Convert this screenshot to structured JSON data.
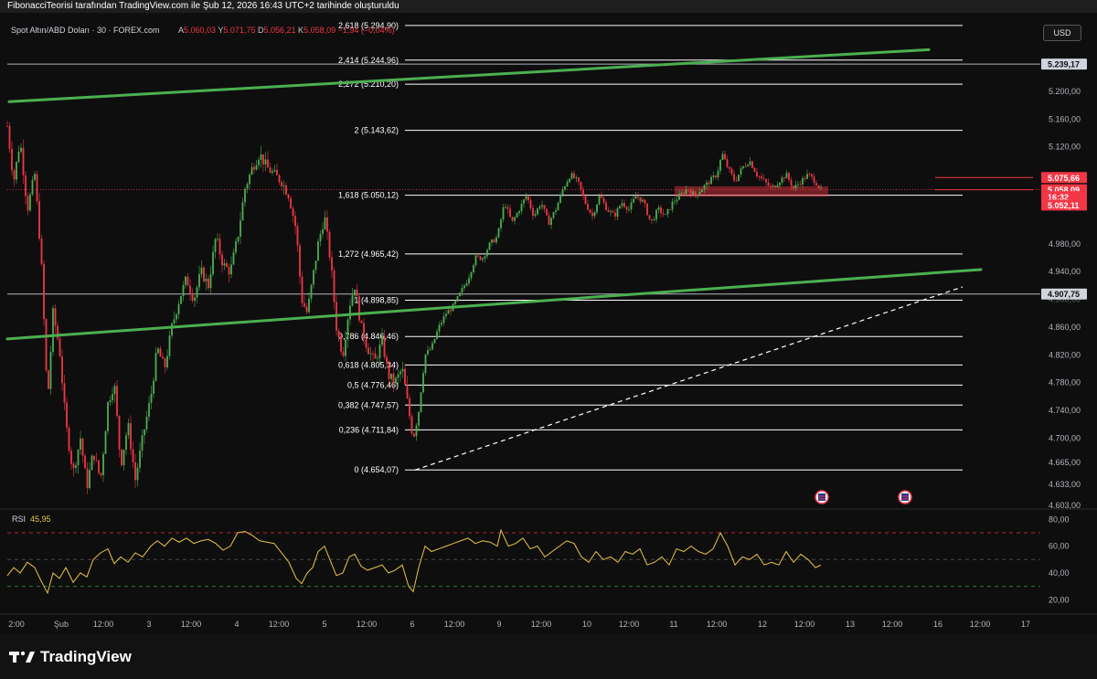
{
  "header": {
    "title": "FibonacciTeorisi tarafından TradingView.com ile Şub 12, 2026 16:43 UTC+2 tarihinde oluşturuldu"
  },
  "symbol": {
    "name": "Spot Altın/ABD Doları · 30 · FOREX.com",
    "open_label": "A",
    "open": "5.060,03",
    "high_label": "Y",
    "high": "5.071,75",
    "low_label": "D",
    "low": "5.056,21",
    "close_label": "K",
    "close": "5.058,09",
    "change": "−1,94 (−0,04%)"
  },
  "currency_button": "USD",
  "footer": {
    "logo_text": "TradingView"
  },
  "colors": {
    "up": "#26a69a",
    "up_candle": "#4caf50",
    "down": "#f23645",
    "trendline": "#4caf50",
    "rsi": "#e8c547",
    "background": "#0e0e0e"
  },
  "chart_data": {
    "type": "candlestick",
    "price_axis": {
      "ylim": [
        4603,
        5300
      ],
      "ticks": [
        "5.200,00",
        "5.160,00",
        "5.120,00",
        "4.980,00",
        "4.940,00",
        "4.860,00",
        "4.820,00",
        "4.780,00",
        "4.740,00",
        "4.700,00",
        "4.665,00",
        "4.633,00",
        "4.603,00"
      ],
      "tick_values": [
        5200,
        5160,
        5120,
        4980,
        4940,
        4860,
        4820,
        4780,
        4740,
        4700,
        4665,
        4633,
        4603
      ],
      "labels": [
        {
          "text": "5.239,17",
          "value": 5239.17,
          "style": "line"
        },
        {
          "text": "5.075,66",
          "value": 5075.66,
          "style": "red"
        },
        {
          "text": "5.058,09",
          "value": 5058.09,
          "style": "red"
        },
        {
          "text": "16:32",
          "value": 5048,
          "style": "red"
        },
        {
          "text": "5.052,11",
          "value": 5036,
          "style": "red"
        },
        {
          "text": "4.907,75",
          "value": 4907.75,
          "style": "line"
        }
      ],
      "partial_tick": "4.900,00"
    },
    "time_axis": {
      "ticks": [
        "2:00",
        "Şub",
        "12:00",
        "3",
        "12:00",
        "4",
        "12:00",
        "5",
        "12:00",
        "6",
        "12:00",
        "9",
        "12:00",
        "10",
        "12:00",
        "11",
        "12:00",
        "12",
        "12:00",
        "13",
        "12:00",
        "16",
        "12:00",
        "17"
      ],
      "tick_x": [
        18,
        67,
        113,
        163,
        209,
        259,
        305,
        355,
        401,
        451,
        497,
        546,
        592,
        642,
        688,
        737,
        784,
        834,
        880,
        930,
        976,
        1026,
        1072,
        1122
      ]
    },
    "fibonacci_levels": [
      {
        "ratio": "2,618",
        "price": "5.294,90",
        "value": 5294.9
      },
      {
        "ratio": "2,414",
        "price": "5.244,96",
        "value": 5244.96
      },
      {
        "ratio": "2,272",
        "price": "5.210,20",
        "value": 5210.2
      },
      {
        "ratio": "2",
        "price": "5.143,62",
        "value": 5143.62
      },
      {
        "ratio": "1,618",
        "price": "5.050,12",
        "value": 5050.12
      },
      {
        "ratio": "1,272",
        "price": "4.965,42",
        "value": 4965.42
      },
      {
        "ratio": "1",
        "price": "4.898,85",
        "value": 4898.85
      },
      {
        "ratio": "0,786",
        "price": "4.846,46",
        "value": 4846.46
      },
      {
        "ratio": "0,618",
        "price": "4.805,34",
        "value": 4805.34
      },
      {
        "ratio": "0,5",
        "price": "4.776,46",
        "value": 4776.46
      },
      {
        "ratio": "0,382",
        "price": "4.747,57",
        "value": 4747.57
      },
      {
        "ratio": "0,236",
        "price": "4.711,84",
        "value": 4711.84
      },
      {
        "ratio": "0",
        "price": "4.654,07",
        "value": 4654.07
      }
    ],
    "horizontal_lines": [
      5239.17,
      4907.75
    ],
    "price_path": [
      [
        8,
        5150
      ],
      [
        15,
        5070
      ],
      [
        22,
        5130
      ],
      [
        30,
        5030
      ],
      [
        38,
        5080
      ],
      [
        45,
        4960
      ],
      [
        52,
        4750
      ],
      [
        58,
        4880
      ],
      [
        65,
        4830
      ],
      [
        72,
        4720
      ],
      [
        80,
        4650
      ],
      [
        88,
        4700
      ],
      [
        95,
        4630
      ],
      [
        102,
        4680
      ],
      [
        110,
        4640
      ],
      [
        118,
        4750
      ],
      [
        125,
        4780
      ],
      [
        132,
        4660
      ],
      [
        140,
        4720
      ],
      [
        148,
        4640
      ],
      [
        156,
        4700
      ],
      [
        165,
        4760
      ],
      [
        172,
        4830
      ],
      [
        180,
        4800
      ],
      [
        188,
        4860
      ],
      [
        196,
        4900
      ],
      [
        204,
        4930
      ],
      [
        212,
        4900
      ],
      [
        220,
        4940
      ],
      [
        228,
        4920
      ],
      [
        236,
        4990
      ],
      [
        244,
        4950
      ],
      [
        252,
        4940
      ],
      [
        260,
        4990
      ],
      [
        268,
        5060
      ],
      [
        276,
        5090
      ],
      [
        284,
        5110
      ],
      [
        292,
        5090
      ],
      [
        300,
        5080
      ],
      [
        308,
        5070
      ],
      [
        316,
        5050
      ],
      [
        324,
        5000
      ],
      [
        330,
        4900
      ],
      [
        336,
        4880
      ],
      [
        342,
        4930
      ],
      [
        348,
        4980
      ],
      [
        355,
        5020
      ],
      [
        362,
        4950
      ],
      [
        368,
        4860
      ],
      [
        375,
        4820
      ],
      [
        382,
        4890
      ],
      [
        388,
        4920
      ],
      [
        395,
        4860
      ],
      [
        402,
        4830
      ],
      [
        410,
        4810
      ],
      [
        418,
        4840
      ],
      [
        425,
        4790
      ],
      [
        432,
        4780
      ],
      [
        440,
        4800
      ],
      [
        447,
        4740
      ],
      [
        452,
        4700
      ],
      [
        458,
        4740
      ],
      [
        465,
        4820
      ],
      [
        472,
        4830
      ],
      [
        480,
        4860
      ],
      [
        488,
        4880
      ],
      [
        496,
        4890
      ],
      [
        504,
        4910
      ],
      [
        512,
        4930
      ],
      [
        520,
        4960
      ],
      [
        528,
        4960
      ],
      [
        536,
        4980
      ],
      [
        544,
        4990
      ],
      [
        552,
        5040
      ],
      [
        560,
        5010
      ],
      [
        568,
        5030
      ],
      [
        576,
        5050
      ],
      [
        584,
        5020
      ],
      [
        592,
        5040
      ],
      [
        600,
        5010
      ],
      [
        608,
        5030
      ],
      [
        616,
        5060
      ],
      [
        624,
        5080
      ],
      [
        632,
        5070
      ],
      [
        640,
        5040
      ],
      [
        648,
        5020
      ],
      [
        656,
        5050
      ],
      [
        664,
        5030
      ],
      [
        672,
        5020
      ],
      [
        680,
        5040
      ],
      [
        688,
        5030
      ],
      [
        696,
        5050
      ],
      [
        704,
        5040
      ],
      [
        712,
        5010
      ],
      [
        720,
        5030
      ],
      [
        728,
        5020
      ],
      [
        736,
        5040
      ],
      [
        744,
        5050
      ],
      [
        752,
        5060
      ],
      [
        760,
        5050
      ],
      [
        768,
        5060
      ],
      [
        776,
        5070
      ],
      [
        784,
        5080
      ],
      [
        790,
        5110
      ],
      [
        796,
        5090
      ],
      [
        804,
        5070
      ],
      [
        812,
        5090
      ],
      [
        820,
        5100
      ],
      [
        828,
        5080
      ],
      [
        836,
        5070
      ],
      [
        844,
        5060
      ],
      [
        852,
        5070
      ],
      [
        860,
        5080
      ],
      [
        868,
        5060
      ],
      [
        876,
        5070
      ],
      [
        884,
        5080
      ],
      [
        892,
        5070
      ],
      [
        898,
        5058
      ]
    ],
    "trendlines": [
      {
        "from": [
          10,
          5185
        ],
        "to": [
          1016,
          5260
        ]
      },
      {
        "from": [
          8,
          4843
        ],
        "to": [
          1073,
          4943
        ]
      }
    ],
    "dashed_line": {
      "from": [
        454,
        4654
      ],
      "to": [
        1053,
        4918
      ]
    },
    "target_lines": [
      {
        "from": [
          1023,
          5075.66
        ],
        "to": [
          1130,
          5075.66
        ]
      },
      {
        "from": [
          1023,
          5058.09
        ],
        "to": [
          1130,
          5058.09
        ]
      }
    ],
    "resistance_zone": {
      "x_from": 738,
      "x_to": 906,
      "low": 5048,
      "high": 5063
    },
    "event_icons_x": [
      899,
      990
    ],
    "rsi": {
      "label": "RSI",
      "value": "45,95",
      "ylim": [
        12,
        85
      ],
      "ticks": [
        "80,00",
        "60,00",
        "40,00",
        "20,00"
      ],
      "tick_values": [
        80,
        60,
        40,
        20
      ],
      "bands": [
        70,
        50,
        30
      ],
      "path": [
        [
          8,
          38
        ],
        [
          15,
          44
        ],
        [
          22,
          40
        ],
        [
          30,
          48
        ],
        [
          38,
          44
        ],
        [
          45,
          34
        ],
        [
          52,
          25
        ],
        [
          58,
          40
        ],
        [
          65,
          36
        ],
        [
          72,
          44
        ],
        [
          80,
          33
        ],
        [
          88,
          40
        ],
        [
          95,
          37
        ],
        [
          102,
          50
        ],
        [
          110,
          55
        ],
        [
          118,
          58
        ],
        [
          125,
          47
        ],
        [
          132,
          52
        ],
        [
          140,
          48
        ],
        [
          148,
          55
        ],
        [
          156,
          52
        ],
        [
          165,
          60
        ],
        [
          172,
          64
        ],
        [
          180,
          60
        ],
        [
          188,
          66
        ],
        [
          196,
          63
        ],
        [
          204,
          66
        ],
        [
          212,
          62
        ],
        [
          220,
          64
        ],
        [
          228,
          65
        ],
        [
          236,
          62
        ],
        [
          244,
          57
        ],
        [
          252,
          60
        ],
        [
          260,
          70
        ],
        [
          268,
          71
        ],
        [
          276,
          68
        ],
        [
          284,
          64
        ],
        [
          292,
          63
        ],
        [
          300,
          62
        ],
        [
          308,
          55
        ],
        [
          316,
          48
        ],
        [
          324,
          36
        ],
        [
          330,
          32
        ],
        [
          336,
          40
        ],
        [
          342,
          44
        ],
        [
          348,
          56
        ],
        [
          355,
          60
        ],
        [
          362,
          48
        ],
        [
          368,
          38
        ],
        [
          375,
          40
        ],
        [
          382,
          52
        ],
        [
          388,
          54
        ],
        [
          395,
          45
        ],
        [
          402,
          42
        ],
        [
          410,
          44
        ],
        [
          418,
          46
        ],
        [
          425,
          40
        ],
        [
          432,
          42
        ],
        [
          440,
          46
        ],
        [
          447,
          30
        ],
        [
          452,
          26
        ],
        [
          458,
          44
        ],
        [
          465,
          60
        ],
        [
          472,
          56
        ],
        [
          480,
          58
        ],
        [
          488,
          60
        ],
        [
          496,
          62
        ],
        [
          504,
          64
        ],
        [
          512,
          66
        ],
        [
          520,
          62
        ],
        [
          528,
          64
        ],
        [
          536,
          63
        ],
        [
          544,
          60
        ],
        [
          548,
          72
        ],
        [
          556,
          60
        ],
        [
          564,
          62
        ],
        [
          572,
          66
        ],
        [
          580,
          58
        ],
        [
          588,
          60
        ],
        [
          596,
          52
        ],
        [
          604,
          56
        ],
        [
          612,
          60
        ],
        [
          620,
          64
        ],
        [
          628,
          62
        ],
        [
          636,
          52
        ],
        [
          644,
          48
        ],
        [
          652,
          56
        ],
        [
          660,
          50
        ],
        [
          668,
          52
        ],
        [
          676,
          48
        ],
        [
          684,
          56
        ],
        [
          692,
          54
        ],
        [
          700,
          58
        ],
        [
          708,
          46
        ],
        [
          716,
          48
        ],
        [
          724,
          52
        ],
        [
          732,
          46
        ],
        [
          740,
          58
        ],
        [
          748,
          56
        ],
        [
          756,
          60
        ],
        [
          764,
          56
        ],
        [
          772,
          54
        ],
        [
          780,
          58
        ],
        [
          788,
          70
        ],
        [
          796,
          60
        ],
        [
          804,
          46
        ],
        [
          812,
          52
        ],
        [
          820,
          50
        ],
        [
          828,
          54
        ],
        [
          836,
          46
        ],
        [
          844,
          48
        ],
        [
          852,
          46
        ],
        [
          860,
          56
        ],
        [
          868,
          48
        ],
        [
          876,
          54
        ],
        [
          884,
          50
        ],
        [
          892,
          44
        ],
        [
          898,
          46
        ]
      ]
    }
  }
}
